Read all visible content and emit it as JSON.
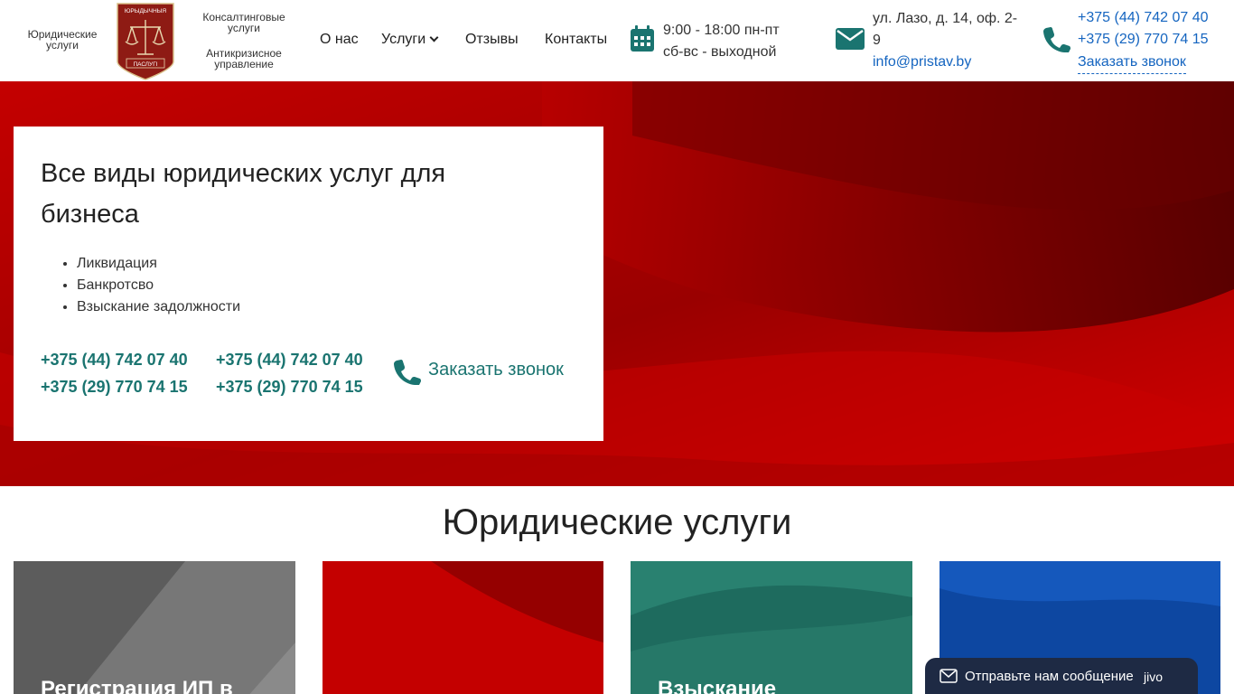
{
  "header": {
    "left_caption": "Юридические услуги",
    "logo": {
      "top_text": "ЮРЫДЫЧНЫЯ",
      "bottom_text": "ПАСЛУГІ",
      "color": "#8e1b14"
    },
    "right_caption_top": "Консалтинговые услуги",
    "right_caption_bottom": "Антикризисное управление",
    "nav": [
      {
        "label": "О нас"
      },
      {
        "label": "Услуги"
      },
      {
        "label": "Отзывы"
      },
      {
        "label": "Контакты"
      }
    ],
    "hours": {
      "line1": "9:00 - 18:00 пн-пт",
      "line2": "сб-вс - выходной"
    },
    "address": "ул. Лазо, д. 14, оф. 2-9",
    "email": "info@pristav.by",
    "phones": [
      "+375 (44) 742 07 40",
      "+375 (29) 770 74 15"
    ],
    "callback": "Заказать звонок"
  },
  "hero": {
    "title": "Все виды юридических услуг для бизнеса",
    "list": [
      "Ликвидация",
      "Банкротсво",
      "Взыскание задолжности"
    ],
    "phones_col1": [
      "+375 (44) 742 07 40",
      "+375 (29) 770 74 15"
    ],
    "phones_col2": [
      "+375 (44) 742 07 40",
      "+375 (29) 770 74 15"
    ],
    "callback": "Заказать звонок"
  },
  "services": {
    "title": "Юридические услуги",
    "cards": [
      {
        "title": "Регистрация ИП в",
        "color": "#5a5a5a"
      },
      {
        "title": "",
        "color": "#c40000"
      },
      {
        "title": "Взыскание",
        "color": "#1e6b5e"
      },
      {
        "title": "",
        "color": "#0d47a1"
      }
    ]
  },
  "chat": {
    "text": "Отправьте нам сообщение",
    "brand": "jivo"
  },
  "colors": {
    "accent_teal": "#1a7470",
    "link_blue": "#1565c0",
    "hero_red": "#b30000"
  }
}
